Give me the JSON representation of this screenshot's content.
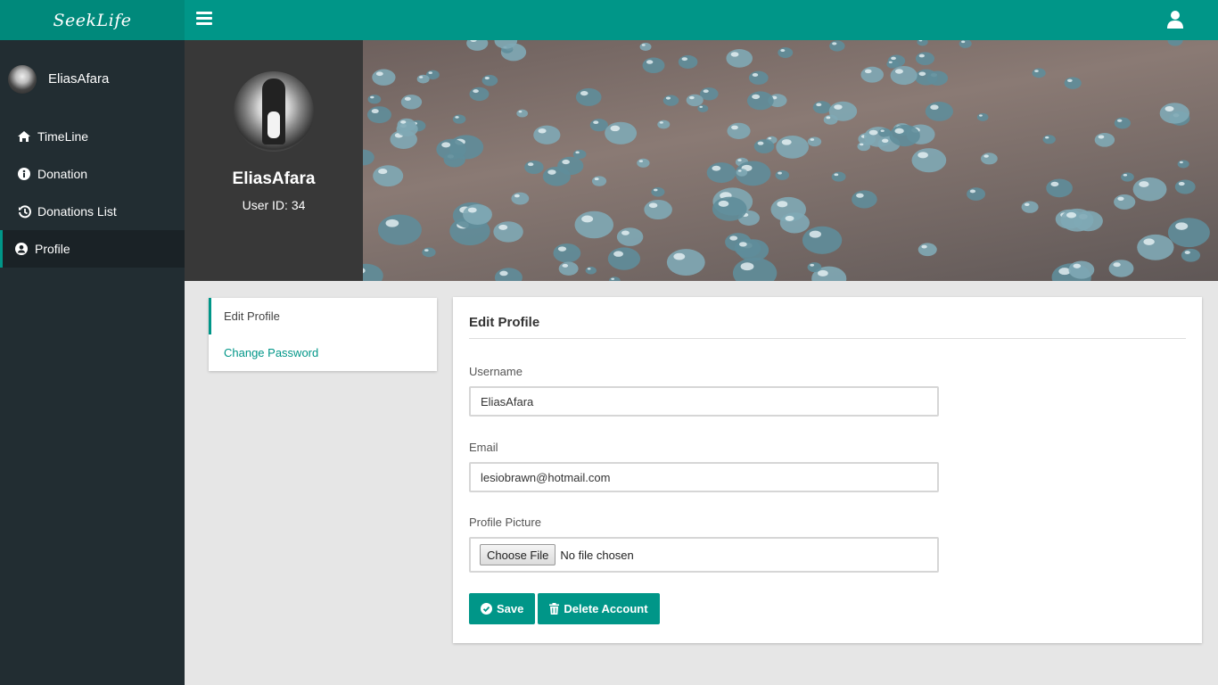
{
  "app": {
    "brand": "SeekLife",
    "accent": "#009688"
  },
  "topbar": {
    "menu_icon": "hamburger-icon",
    "user_icon": "user-icon"
  },
  "sidebar": {
    "username": "EliasAfara",
    "items": [
      {
        "label": "TimeLine",
        "icon": "home-icon"
      },
      {
        "label": "Donation",
        "icon": "info-circle-icon"
      },
      {
        "label": "Donations List",
        "icon": "history-icon"
      },
      {
        "label": "Profile",
        "icon": "user-circle-icon",
        "active": true
      }
    ]
  },
  "profile_header": {
    "name": "EliasAfara",
    "user_id": "User ID: 34"
  },
  "tabs": [
    {
      "label": "Edit Profile",
      "active": true
    },
    {
      "label": "Change Password",
      "active": false
    }
  ],
  "form": {
    "title": "Edit Profile",
    "username_label": "Username",
    "username_value": "EliasAfara",
    "email_label": "Email",
    "email_value": "lesiobrawn@hotmail.com",
    "picture_label": "Profile Picture",
    "choose_file_label": "Choose File",
    "no_file_text": "No file chosen",
    "save_label": "Save",
    "delete_label": "Delete Account"
  }
}
